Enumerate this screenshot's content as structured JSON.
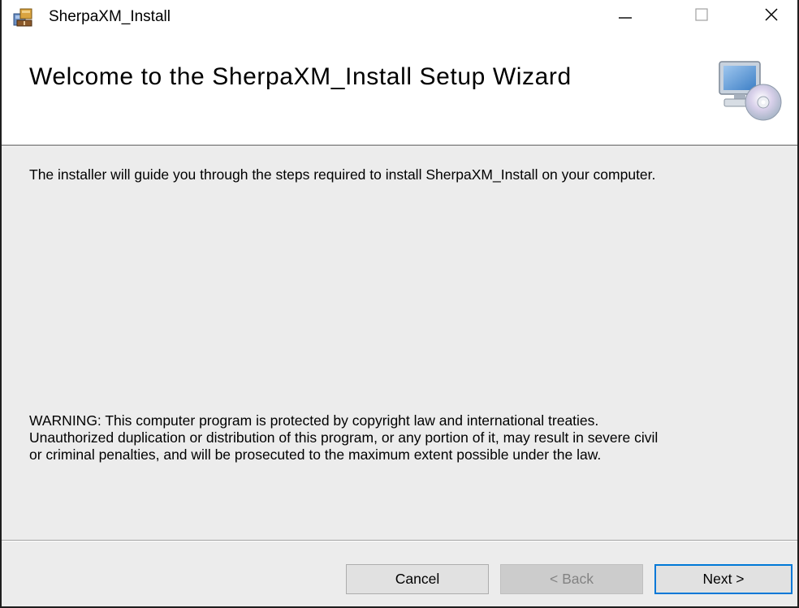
{
  "window": {
    "title": "SherpaXM_Install",
    "controls": {
      "minimize": "minimize-icon",
      "maximize": "maximize-icon",
      "close": "close-icon"
    }
  },
  "banner": {
    "title": "Welcome to the SherpaXM_Install Setup Wizard",
    "icon": "computer-cd-icon"
  },
  "body": {
    "intro": "The installer will guide you through the steps required to install SherpaXM_Install on your computer.",
    "warning_lines": [
      "WARNING: This computer program is protected by copyright law and international treaties.",
      "Unauthorized duplication or distribution of this program, or any portion of it, may result in severe civil",
      "or criminal penalties, and will be prosecuted to the maximum extent possible under the law."
    ]
  },
  "buttons": {
    "cancel": "Cancel",
    "back": "< Back",
    "next": "Next >"
  },
  "colors": {
    "panel_bg": "#ececec",
    "focus_border": "#0078d7",
    "disabled_text": "#838383"
  }
}
